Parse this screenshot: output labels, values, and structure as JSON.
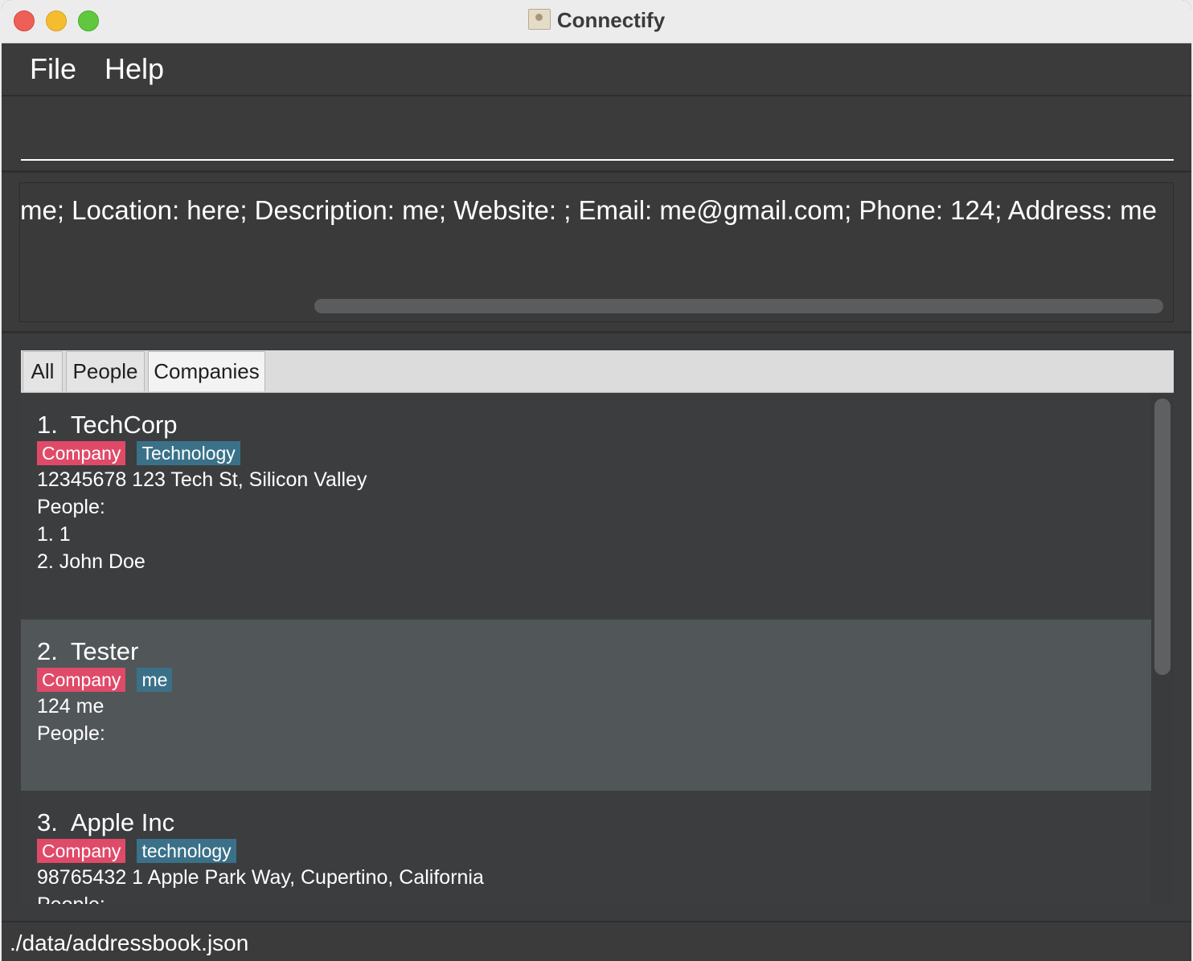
{
  "window": {
    "title": "Connectify"
  },
  "menu": {
    "file": "File",
    "help": "Help"
  },
  "command": {
    "value": "",
    "placeholder": ""
  },
  "result": {
    "message": "Company added: Tester; Industry: me; Location: here; Description: me; Website: ; Email: me@gmail.com; Phone: 124; Address: me",
    "visible_text": ":ry: me; Location: here; Description: me; Website: ; Email: me@gmail.com; Phone: 124; Address: me"
  },
  "tabs": [
    {
      "label": "All",
      "selected": false
    },
    {
      "label": "People",
      "selected": false
    },
    {
      "label": "Companies",
      "selected": true
    }
  ],
  "companies": [
    {
      "index": "1.",
      "name": "TechCorp",
      "tags": [
        "Company",
        "Technology"
      ],
      "details": "12345678  123 Tech St, Silicon Valley",
      "people_label": "People:",
      "people": [
        "1. 1",
        "2. John Doe"
      ],
      "selected": false
    },
    {
      "index": "2.",
      "name": "Tester",
      "tags": [
        "Company",
        "me"
      ],
      "details": "124  me",
      "people_label": "People:",
      "people": [],
      "selected": true
    },
    {
      "index": "3.",
      "name": "Apple Inc",
      "tags": [
        "Company",
        "technology"
      ],
      "details": "98765432  1 Apple Park Way, Cupertino, California",
      "people_label": "People:",
      "people": [],
      "selected": false
    }
  ],
  "status": {
    "path": "./data/addressbook.json"
  },
  "colors": {
    "company_tag": "#e04a69",
    "industry_tag": "#3a7189",
    "selected_card": "#515659",
    "background": "#3c3d3f"
  }
}
